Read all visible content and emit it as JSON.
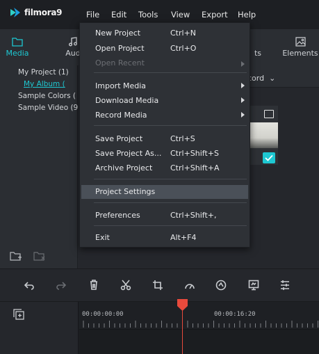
{
  "app": {
    "name": "filmora9",
    "menus": [
      "File",
      "Edit",
      "Tools",
      "View",
      "Export",
      "Help"
    ]
  },
  "tabs": [
    {
      "label": "Media",
      "icon": "folder-icon",
      "active": true
    },
    {
      "label": "Aud",
      "icon": "music-note-icon",
      "active": false
    },
    {
      "label": "ts",
      "icon": "",
      "active": false
    },
    {
      "label": "Elements",
      "icon": "image-icon",
      "active": false
    }
  ],
  "media_tree": [
    {
      "label": "My Project (1)"
    },
    {
      "label": "My Album ("
    },
    {
      "label": "Sample Colors ("
    },
    {
      "label": "Sample Video (9"
    }
  ],
  "toolstrip": {
    "text": "cord"
  },
  "file_menu": {
    "items": [
      {
        "label": "New Project",
        "shortcut": "Ctrl+N"
      },
      {
        "label": "Open Project",
        "shortcut": "Ctrl+O"
      },
      {
        "label": "Open Recent",
        "shortcut": ""
      },
      {
        "label": "Import Media",
        "shortcut": ""
      },
      {
        "label": "Download Media",
        "shortcut": ""
      },
      {
        "label": "Record Media",
        "shortcut": ""
      },
      {
        "label": "Save Project",
        "shortcut": "Ctrl+S"
      },
      {
        "label": "Save Project As...",
        "shortcut": "Ctrl+Shift+S"
      },
      {
        "label": "Archive Project",
        "shortcut": "Ctrl+Shift+A"
      },
      {
        "label": "Project Settings",
        "shortcut": ""
      },
      {
        "label": "Preferences",
        "shortcut": "Ctrl+Shift+,"
      },
      {
        "label": "Exit",
        "shortcut": "Alt+F4"
      }
    ]
  },
  "timeline": {
    "time_start": "00:00:00:00",
    "time_mark": "00:00:16:20"
  },
  "colors": {
    "accent": "#1ec8d2",
    "playhead": "#e84a3c",
    "menu_bg": "#2e3136",
    "highlight": "#4a5058"
  }
}
